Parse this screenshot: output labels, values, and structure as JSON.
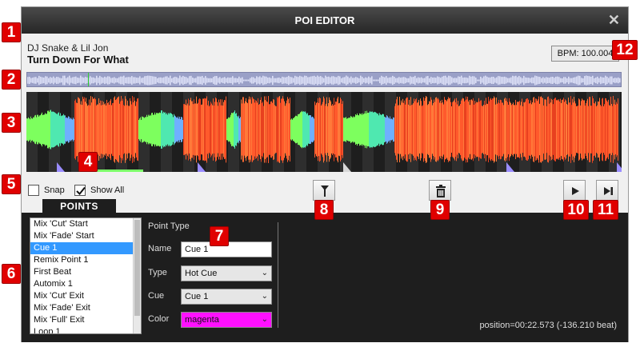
{
  "window": {
    "title": "POI EDITOR",
    "close_glyph": "✕"
  },
  "track": {
    "artist": "DJ Snake & Lil Jon",
    "title": "Turn Down For What",
    "bpm_label": "BPM: 100.004"
  },
  "controls": {
    "snap_label": "Snap",
    "snap_checked": false,
    "showall_label": "Show All",
    "showall_checked": true,
    "buttons": [
      "marker-add-icon",
      "trash-icon",
      "play-icon",
      "play-next-icon"
    ]
  },
  "tab": {
    "label": "POINTS"
  },
  "points": {
    "items": [
      "Mix 'Cut' Start",
      "Mix 'Fade' Start",
      "Cue 1",
      "Remix Point 1",
      "First Beat",
      "Automix 1",
      "Mix 'Cut' Exit",
      "Mix 'Fade' Exit",
      "Mix 'Full' Exit",
      "Loop 1"
    ],
    "selected_index": 2
  },
  "point_type": {
    "heading": "Point Type",
    "name_label": "Name",
    "name_value": "Cue 1",
    "type_label": "Type",
    "type_value": "Hot Cue",
    "cue_label": "Cue",
    "cue_value": "Cue 1",
    "color_label": "Color",
    "color_value": "magenta"
  },
  "status": {
    "position": "position=00:22.573 (-136.210 beat)"
  },
  "callouts": [
    "1",
    "2",
    "3",
    "4",
    "5",
    "6",
    "7",
    "8",
    "9",
    "10",
    "11",
    "12"
  ],
  "colors": {
    "title_bar": "#2f2f2f",
    "panel": "#1e1e1e",
    "selection": "#3399ff",
    "callout": "#e00000",
    "cue_color": "#ff10ff",
    "wave_high": "#ff5a2c",
    "wave_low": "#66ff99"
  }
}
